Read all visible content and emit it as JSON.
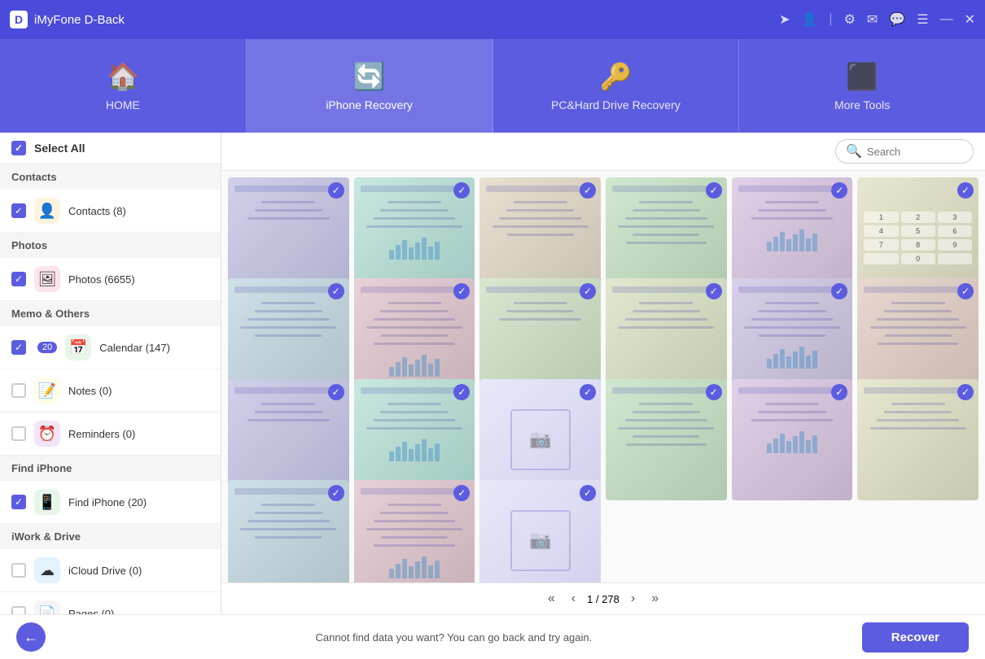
{
  "app": {
    "name": "iMyFone D-Back",
    "logo": "D"
  },
  "window_controls": [
    "share",
    "user",
    "settings",
    "mail",
    "chat",
    "menu",
    "minimize",
    "close"
  ],
  "nav": {
    "tabs": [
      {
        "id": "home",
        "label": "HOME",
        "icon": "🏠"
      },
      {
        "id": "iphone-recovery",
        "label": "iPhone Recovery",
        "icon": "🔄",
        "active": true
      },
      {
        "id": "pc-recovery",
        "label": "PC&Hard Drive Recovery",
        "icon": "🔑"
      },
      {
        "id": "more-tools",
        "label": "More Tools",
        "icon": "⬛"
      }
    ]
  },
  "sidebar": {
    "select_all_label": "Select All",
    "sections": [
      {
        "name": "Contacts",
        "items": [
          {
            "id": "contacts",
            "label": "Contacts (8)",
            "icon": "👤",
            "checked": true,
            "icon_class": "icon-contacts"
          }
        ]
      },
      {
        "name": "Photos",
        "items": [
          {
            "id": "photos",
            "label": "Photos (6655)",
            "icon": "🖼",
            "checked": true,
            "icon_class": "icon-photos"
          }
        ]
      },
      {
        "name": "Memo & Others",
        "items": [
          {
            "id": "calendar",
            "label": "Calendar (147)",
            "icon": "📅",
            "checked": true,
            "badge": "20",
            "icon_class": "icon-calendar"
          },
          {
            "id": "notes",
            "label": "Notes (0)",
            "icon": "📝",
            "checked": false,
            "icon_class": "icon-notes"
          },
          {
            "id": "reminders",
            "label": "Reminders (0)",
            "icon": "⏰",
            "checked": false,
            "icon_class": "icon-reminders"
          }
        ]
      },
      {
        "name": "Find iPhone",
        "items": [
          {
            "id": "find-iphone",
            "label": "Find iPhone (20)",
            "icon": "📱",
            "checked": true,
            "icon_class": "icon-findphone"
          }
        ]
      },
      {
        "name": "iWork & Drive",
        "items": [
          {
            "id": "icloud-drive",
            "label": "iCloud Drive (0)",
            "icon": "☁",
            "checked": false,
            "icon_class": "icon-icloud"
          },
          {
            "id": "pages",
            "label": "Pages (0)",
            "icon": "📄",
            "checked": false,
            "icon_class": "icon-pages"
          }
        ]
      }
    ]
  },
  "toolbar": {
    "search_placeholder": "Search"
  },
  "grid": {
    "items": [
      {
        "type": "screen",
        "checked": true
      },
      {
        "type": "screen",
        "checked": true
      },
      {
        "type": "screen",
        "checked": true
      },
      {
        "type": "screen",
        "checked": true
      },
      {
        "type": "screen",
        "checked": true
      },
      {
        "type": "numpad",
        "checked": true
      },
      {
        "type": "screen",
        "checked": true
      },
      {
        "type": "screen",
        "checked": true
      },
      {
        "type": "screen",
        "checked": true
      },
      {
        "type": "screen",
        "checked": true
      },
      {
        "type": "screen",
        "checked": true
      },
      {
        "type": "screen",
        "checked": true
      },
      {
        "type": "screen",
        "checked": true
      },
      {
        "type": "screen",
        "checked": true
      },
      {
        "type": "placeholder",
        "checked": true
      },
      {
        "type": "screen",
        "checked": true
      },
      {
        "type": "screen",
        "checked": true
      },
      {
        "type": "screen",
        "checked": true
      },
      {
        "type": "screen",
        "checked": true
      },
      {
        "type": "screen",
        "checked": true
      },
      {
        "type": "placeholder",
        "checked": true
      }
    ]
  },
  "pagination": {
    "current": 1,
    "total": 278,
    "display": "1 / 278"
  },
  "bottom": {
    "message": "Cannot find data you want? You can go back and try again.",
    "recover_label": "Recover",
    "back_icon": "←"
  }
}
